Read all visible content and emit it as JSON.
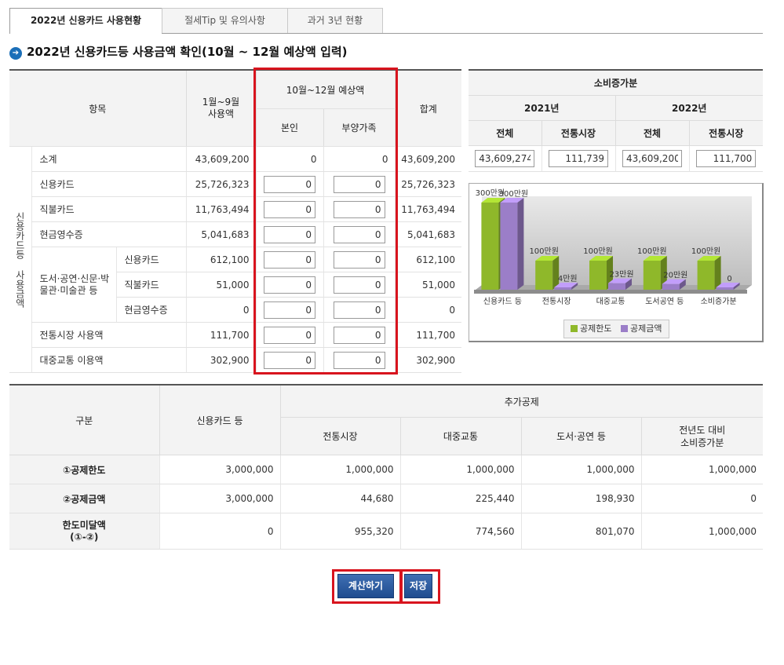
{
  "tabs": [
    {
      "label": "2022년 신용카드 사용현황",
      "active": true
    },
    {
      "label": "절세Tip 및 유의사항",
      "active": false
    },
    {
      "label": "과거 3년 현황",
      "active": false
    }
  ],
  "section_title": "2022년 신용카드등 사용금액 확인(10월 ~ 12월 예상액 입력)",
  "main_table": {
    "headers": {
      "item": "항목",
      "jan_sep": "1월~9월\n사용액",
      "oct_dec": "10월~12월 예상액",
      "self": "본인",
      "dependent": "부양가족",
      "total": "합계"
    },
    "group_label": "신용카드등 사용금액",
    "culture_label": "도서·공연·신문·박물관·미술관 등",
    "rows": [
      {
        "label": "소계",
        "jan_sep": "43,609,200",
        "self": "0",
        "dependent": "0",
        "total": "43,609,200"
      },
      {
        "label": "신용카드",
        "jan_sep": "25,726,323",
        "self": "0",
        "dependent": "0",
        "total": "25,726,323"
      },
      {
        "label": "직불카드",
        "jan_sep": "11,763,494",
        "self": "0",
        "dependent": "0",
        "total": "11,763,494"
      },
      {
        "label": "현금영수증",
        "jan_sep": "5,041,683",
        "self": "0",
        "dependent": "0",
        "total": "5,041,683"
      },
      {
        "label": "신용카드",
        "jan_sep": "612,100",
        "self": "0",
        "dependent": "0",
        "total": "612,100"
      },
      {
        "label": "직불카드",
        "jan_sep": "51,000",
        "self": "0",
        "dependent": "0",
        "total": "51,000"
      },
      {
        "label": "현금영수증",
        "jan_sep": "0",
        "self": "0",
        "dependent": "0",
        "total": "0"
      },
      {
        "label": "전통시장 사용액",
        "jan_sep": "111,700",
        "self": "0",
        "dependent": "0",
        "total": "111,700"
      },
      {
        "label": "대중교통 이용액",
        "jan_sep": "302,900",
        "self": "0",
        "dependent": "0",
        "total": "302,900"
      }
    ]
  },
  "increase_table": {
    "title": "소비증가분",
    "years": [
      "2021년",
      "2022년"
    ],
    "subheaders": [
      "전체",
      "전통시장",
      "전체",
      "전통시장"
    ],
    "values": [
      "43,609,274",
      "111,739",
      "43,609,200",
      "111,700"
    ]
  },
  "chart_data": {
    "type": "bar",
    "categories": [
      "신용카드 등",
      "전통시장",
      "대중교통",
      "도서공연 등",
      "소비증가분"
    ],
    "series": [
      {
        "name": "공제한도",
        "values": [
          3000000,
          1000000,
          1000000,
          1000000,
          1000000
        ],
        "labels": [
          "300만원",
          "100만원",
          "100만원",
          "100만원",
          "100만원"
        ],
        "color": "#8fb82a"
      },
      {
        "name": "공제금액",
        "values": [
          3000000,
          44680,
          225440,
          198930,
          0
        ],
        "labels": [
          "300만원",
          "4만원",
          "23만원",
          "20만원",
          "0"
        ],
        "color": "#9b7ec8"
      }
    ],
    "ylim": [
      0,
      3000000
    ]
  },
  "deduction_table": {
    "headers": {
      "category": "구분",
      "credit": "신용카드 등",
      "additional": "추가공제",
      "market": "전통시장",
      "transit": "대중교통",
      "culture": "도서·공연 등",
      "increase": "전년도 대비\n소비증가분"
    },
    "rows": [
      {
        "label": "①공제한도",
        "values": [
          "3,000,000",
          "1,000,000",
          "1,000,000",
          "1,000,000",
          "1,000,000"
        ]
      },
      {
        "label": "②공제금액",
        "values": [
          "3,000,000",
          "44,680",
          "225,440",
          "198,930",
          "0"
        ]
      },
      {
        "label": "한도미달액\n(①-②)",
        "values": [
          "0",
          "955,320",
          "774,560",
          "801,070",
          "1,000,000"
        ]
      }
    ]
  },
  "buttons": {
    "calculate": "계산하기",
    "save": "저장"
  }
}
